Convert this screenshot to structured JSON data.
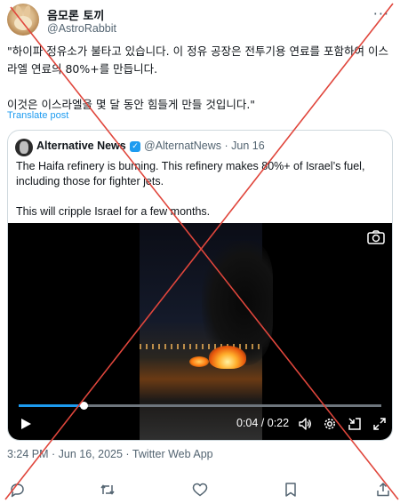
{
  "tweet": {
    "author_name": "음모론 토끼",
    "author_handle": "@AstroRabbit",
    "text": "\"하이파 정유소가 불타고 있습니다. 이 정유 공장은 전투기용 연료를 포함하여 이스라엘 연료의 80%+를 만듭니다.\n\n이것은 이스라엘을 몇 달 동안 힘들게 만들 것입니다.\"",
    "translate_label": "Translate post",
    "timestamp": "3:24 PM · Jun 16, 2025 · Twitter Web App"
  },
  "quote": {
    "author_name": "Alternative News",
    "meta": "@AlternatNews · Jun 16",
    "text": "The Haifa refinery is burning. This refinery makes 80%+ of Israel’s fuel, including those for fighter jets.\n\nThis will cripple Israel for a few months."
  },
  "video": {
    "time_label": "0:04 / 0:22",
    "progress": 0.18
  },
  "colors": {
    "accent": "#1d9bf0",
    "cross": "#e0463c",
    "muted": "#536471"
  }
}
